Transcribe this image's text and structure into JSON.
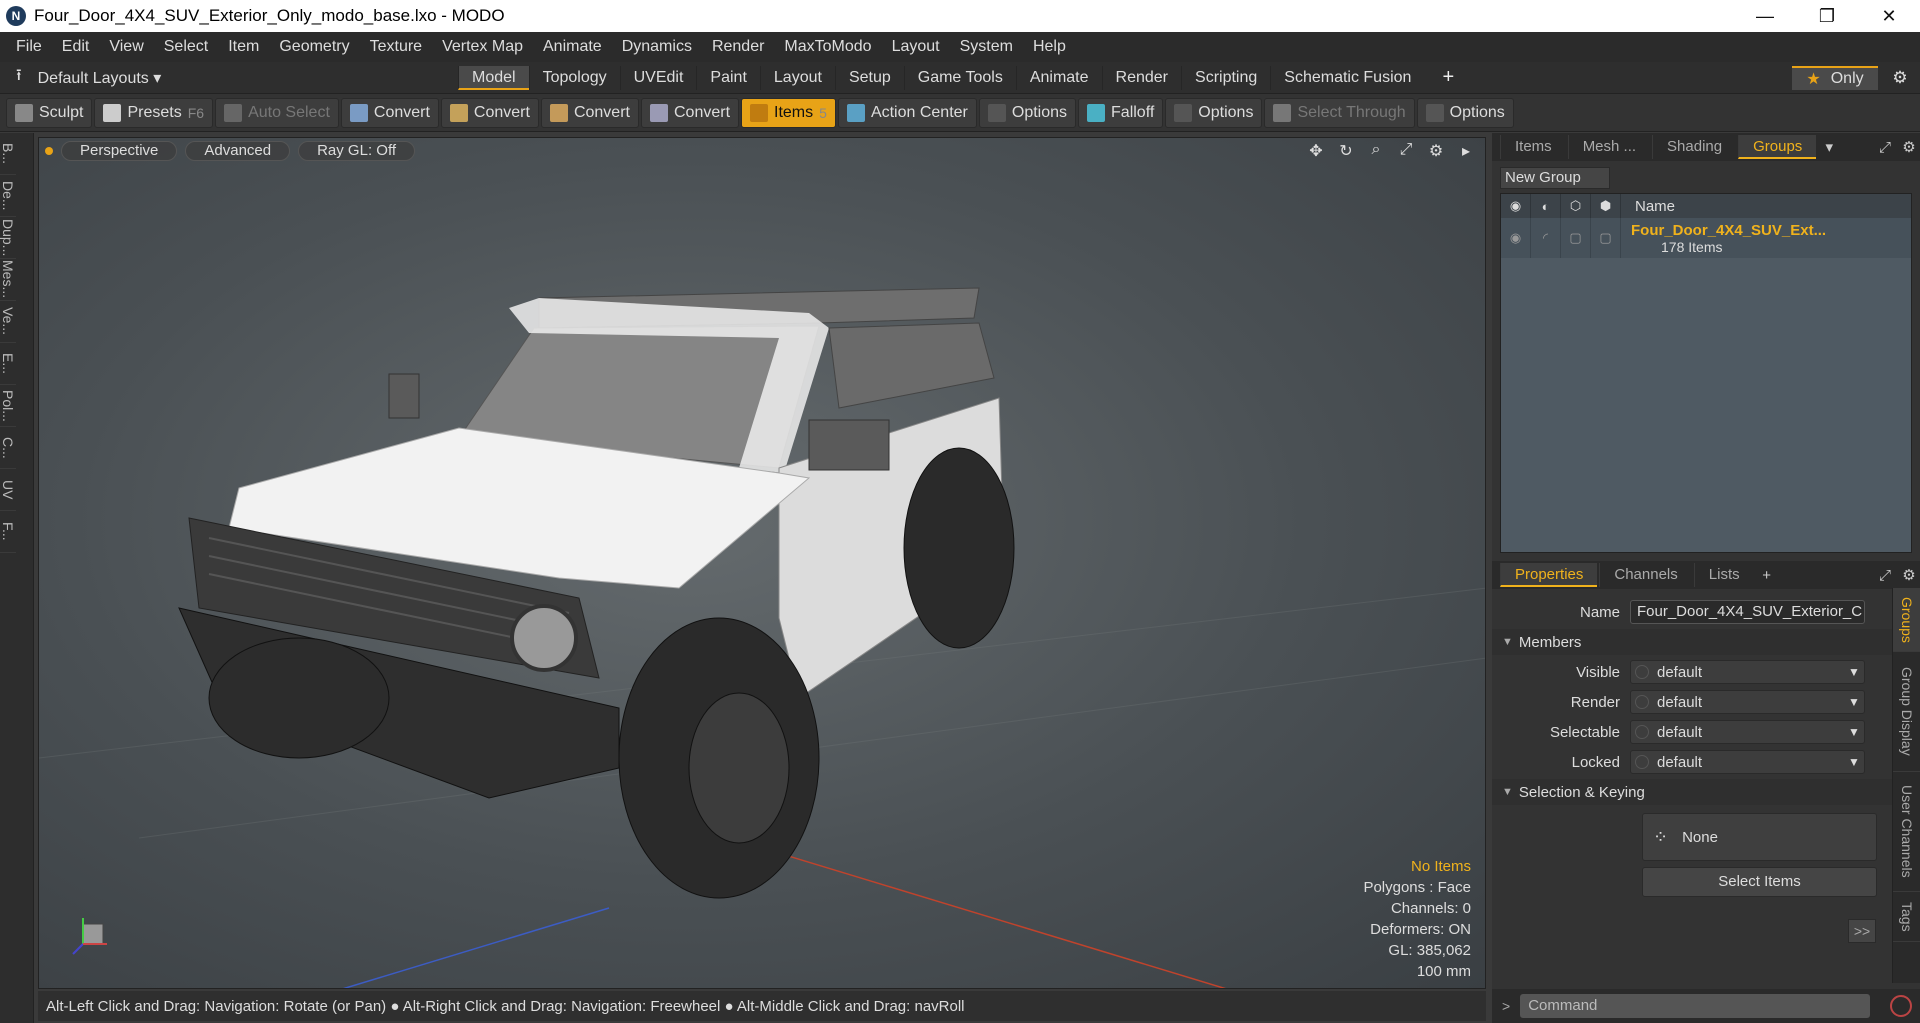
{
  "window": {
    "title": "Four_Door_4X4_SUV_Exterior_Only_modo_base.lxo - MODO",
    "logo_letter": "N",
    "controls": [
      "—",
      "❐",
      "✕"
    ]
  },
  "menu": [
    "File",
    "Edit",
    "View",
    "Select",
    "Item",
    "Geometry",
    "Texture",
    "Vertex Map",
    "Animate",
    "Dynamics",
    "Render",
    "MaxToModo",
    "Layout",
    "System",
    "Help"
  ],
  "layouts": {
    "label": "Default Layouts ▾",
    "icon": "⭱"
  },
  "tabs": [
    {
      "label": "Model",
      "active": true
    },
    {
      "label": "Topology"
    },
    {
      "label": "UVEdit"
    },
    {
      "label": "Paint"
    },
    {
      "label": "Layout"
    },
    {
      "label": "Setup"
    },
    {
      "label": "Game Tools"
    },
    {
      "label": "Animate"
    },
    {
      "label": "Render"
    },
    {
      "label": "Scripting"
    },
    {
      "label": "Schematic Fusion"
    }
  ],
  "tabbar_right": {
    "plus": "+",
    "only_star": "★",
    "only_label": "Only",
    "gear": "⚙"
  },
  "toolbar": [
    {
      "label": "Sculpt",
      "icon": "sculpt-icon",
      "color": "#888"
    },
    {
      "label": "Presets",
      "hotkey": "F6",
      "icon": "presets-icon",
      "color": "#ccc"
    },
    {
      "label": "Auto Select",
      "dim": true,
      "icon": "auto-select-icon",
      "color": "#666"
    },
    {
      "label": "Convert",
      "icon": "convert-icon",
      "color": "#7a9bc4"
    },
    {
      "label": "Convert",
      "icon": "convert-icon",
      "color": "#c4a15a"
    },
    {
      "label": "Convert",
      "icon": "convert-icon",
      "color": "#c49a5a"
    },
    {
      "label": "Convert",
      "icon": "convert-icon",
      "color": "#9a9ab4"
    },
    {
      "label": "Items",
      "hotkey": "5",
      "active": true,
      "icon": "items-icon",
      "color": "#c07c10"
    },
    {
      "label": "Action Center",
      "icon": "action-center-icon",
      "color": "#5aa0c4"
    },
    {
      "label": "Options",
      "icon": "options-icon",
      "color": "#555"
    },
    {
      "label": "Falloff",
      "icon": "falloff-icon",
      "color": "#4ab0c4"
    },
    {
      "label": "Options",
      "icon": "options-icon",
      "color": "#555"
    },
    {
      "label": "Select Through",
      "dim": true,
      "icon": "select-through-icon",
      "color": "#777"
    },
    {
      "label": "Options",
      "icon": "options-icon",
      "color": "#555"
    }
  ],
  "left_tabs": [
    "B...",
    "De...",
    "Dup...",
    "Mes...",
    "Ve...",
    "E...",
    "Pol...",
    "C...",
    "UV",
    "F..."
  ],
  "viewport": {
    "buttons": [
      "Perspective",
      "Advanced",
      "Ray GL: Off"
    ],
    "icons": [
      "✥",
      "↻",
      "⌕",
      "⤢",
      "⚙",
      "▸"
    ],
    "stats": {
      "no_items": "No Items",
      "polygons": "Polygons : Face",
      "channels": "Channels: 0",
      "deformers": "Deformers: ON",
      "gl": "GL: 385,062",
      "unit": "100 mm"
    }
  },
  "statusbar": "Alt-Left Click and Drag: Navigation: Rotate (or Pan) ● Alt-Right Click and Drag: Navigation: Freewheel ● Alt-Middle Click and Drag: navRoll",
  "right_top": {
    "tabs": [
      "Items",
      "Mesh ...",
      "Shading",
      "Groups"
    ],
    "active": "Groups",
    "new_group": "New Group",
    "header_name": "Name",
    "group_name": "Four_Door_4X4_SUV_Ext...",
    "group_count": "178 Items"
  },
  "right_bottom": {
    "tabs": [
      "Properties",
      "Channels",
      "Lists"
    ],
    "plus": "+",
    "name_label": "Name",
    "name_value": "Four_Door_4X4_SUV_Exterior_C",
    "members_label": "Members",
    "visible_label": "Visible",
    "render_label": "Render",
    "selectable_label": "Selectable",
    "locked_label": "Locked",
    "default_value": "default",
    "selection_label": "Selection & Keying",
    "none_label": "None",
    "select_items": "Select Items",
    "expand": ">>",
    "vtabs": [
      "Groups",
      "Group Display",
      "User Channels",
      "Tags"
    ]
  },
  "command": {
    "prompt": ">",
    "placeholder": "Command"
  }
}
